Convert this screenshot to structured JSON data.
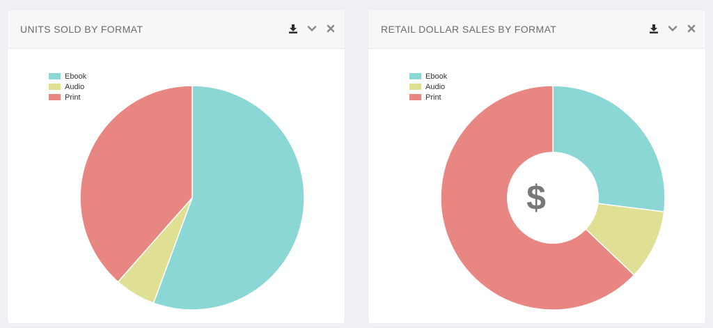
{
  "panels": [
    {
      "title": "UNITS SOLD BY FORMAT",
      "icons": [
        "download-icon",
        "chevron-down-icon",
        "close-icon"
      ],
      "legend": [
        "Ebook",
        "Audio",
        "Print"
      ]
    },
    {
      "title": "RETAIL DOLLAR SALES BY FORMAT",
      "icons": [
        "download-icon",
        "chevron-down-icon",
        "close-icon"
      ],
      "legend": [
        "Ebook",
        "Audio",
        "Print"
      ],
      "center_symbol": "$"
    }
  ],
  "colors": {
    "Ebook": "#8ad7d5",
    "Audio": "#dfe093",
    "Print": "#e88682",
    "icon": "#8a8a8e",
    "dollar": "#777777"
  },
  "chart_data": [
    {
      "type": "pie",
      "title": "UNITS SOLD BY FORMAT",
      "categories": [
        "Ebook",
        "Audio",
        "Print"
      ],
      "values": [
        55.6,
        5.9,
        38.5
      ]
    },
    {
      "type": "pie",
      "title": "RETAIL DOLLAR SALES BY FORMAT",
      "donut": true,
      "categories": [
        "Ebook",
        "Audio",
        "Print"
      ],
      "values": [
        27.0,
        10.1,
        62.9
      ]
    }
  ]
}
